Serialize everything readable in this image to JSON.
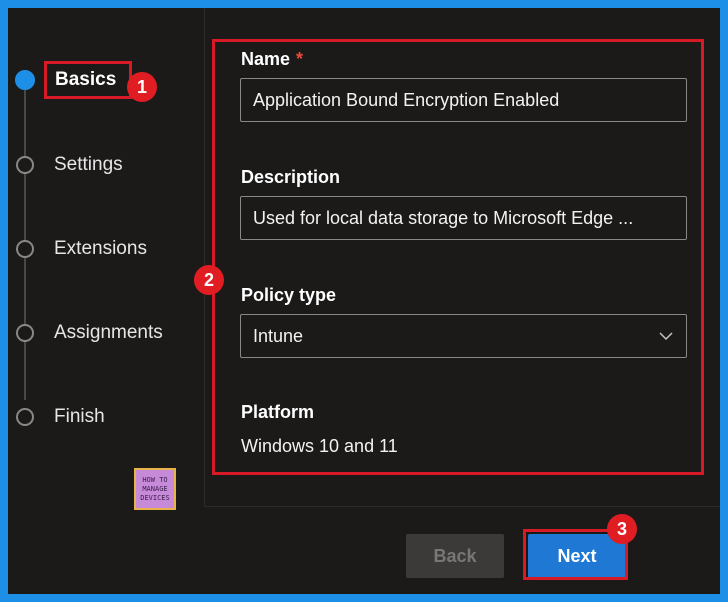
{
  "steps": [
    {
      "label": "Basics",
      "active": true
    },
    {
      "label": "Settings",
      "active": false
    },
    {
      "label": "Extensions",
      "active": false
    },
    {
      "label": "Assignments",
      "active": false
    },
    {
      "label": "Finish",
      "active": false
    }
  ],
  "form": {
    "name_label": "Name",
    "required_marker": "*",
    "name_value": "Application Bound Encryption Enabled",
    "description_label": "Description",
    "description_value": "Used for local data storage to Microsoft Edge ...",
    "policy_type_label": "Policy type",
    "policy_type_value": "Intune",
    "platform_label": "Platform",
    "platform_value": "Windows 10 and 11"
  },
  "footer": {
    "back_label": "Back",
    "next_label": "Next"
  },
  "annotations": {
    "badge_1": "1",
    "badge_2": "2",
    "badge_3": "3"
  },
  "logo": {
    "line1": "HOW TO",
    "line2": "MANAGE",
    "line3": "DEVICES"
  },
  "colors": {
    "accent": "#1e8fe6",
    "highlight": "#d61a26",
    "background": "#1b1a19"
  }
}
